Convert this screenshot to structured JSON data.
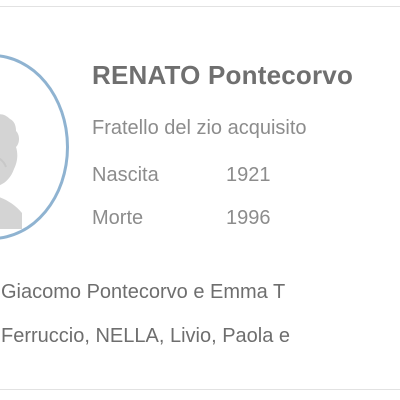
{
  "person": {
    "name": "RENATO Pontecorvo",
    "relation": "Fratello del zio acquisito",
    "birth_label": "Nascita",
    "birth_year": "1921",
    "death_label": "Morte",
    "death_year": "1996"
  },
  "relatives": {
    "parents": "Giacomo Pontecorvo e Emma T",
    "siblings": "Ferruccio, NELLA, Livio, Paola e"
  },
  "icons": {
    "avatar": "person-silhouette-icon"
  },
  "colors": {
    "avatar_ring": "#8fb3d1",
    "name_text": "#6f6f6f",
    "detail_text": "#8c8c8c",
    "card_border": "#e2e2e2"
  }
}
